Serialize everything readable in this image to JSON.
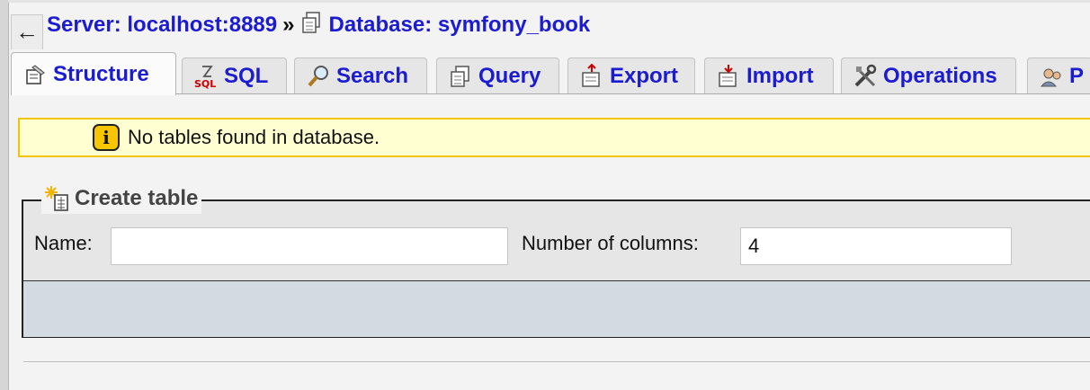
{
  "nav": {
    "back_symbol": "←",
    "breadcrumb": {
      "server_label": "Server: localhost:8889",
      "separator": "»",
      "database_label": "Database: symfony_book"
    }
  },
  "tabs": [
    {
      "label": "Structure",
      "icon": "structure-icon",
      "active": true
    },
    {
      "label": "SQL",
      "icon": "sql-icon",
      "active": false
    },
    {
      "label": "Search",
      "icon": "search-icon",
      "active": false
    },
    {
      "label": "Query",
      "icon": "query-icon",
      "active": false
    },
    {
      "label": "Export",
      "icon": "export-icon",
      "active": false
    },
    {
      "label": "Import",
      "icon": "import-icon",
      "active": false
    },
    {
      "label": "Operations",
      "icon": "operations-icon",
      "active": false
    },
    {
      "label": "P",
      "icon": "privileges-icon",
      "active": false
    }
  ],
  "notice": {
    "icon_glyph": "i",
    "text": "No tables found in database."
  },
  "create_table": {
    "legend": "Create table",
    "name_label": "Name:",
    "name_value": "",
    "columns_label": "Number of columns:",
    "columns_value": "4"
  },
  "colors": {
    "link": "#1b1bd1",
    "notice_bg": "#ffffd1",
    "notice_border": "#f2c500",
    "fieldset_footer": "#d3dae1"
  }
}
